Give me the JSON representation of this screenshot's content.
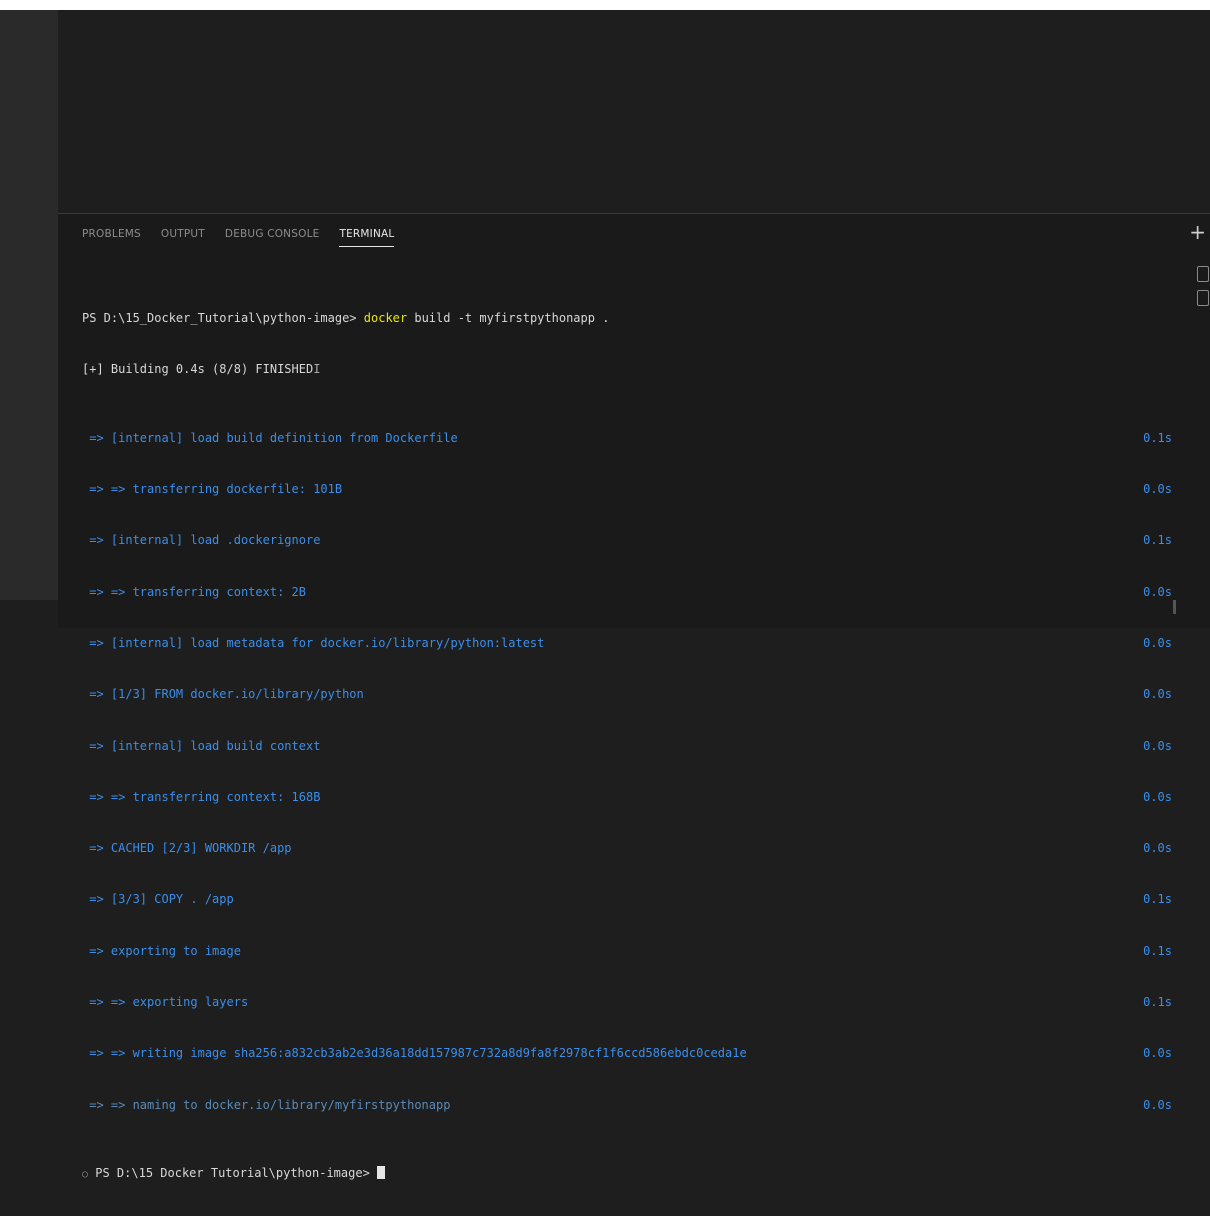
{
  "panel": {
    "tabs": [
      {
        "label": "PROBLEMS"
      },
      {
        "label": "OUTPUT"
      },
      {
        "label": "DEBUG CONSOLE"
      },
      {
        "label": "TERMINAL"
      }
    ],
    "new_terminal": "+"
  },
  "terminal": {
    "prompt1": "PS D:\\15_Docker_Tutorial\\python-image> ",
    "cmd_docker": "docker",
    "cmd_rest": " build -t myfirstpythonapp .",
    "building": "[+] Building 0.4s (8/8) FINISHED",
    "steps": [
      {
        "text": " => [internal] load build definition from Dockerfile",
        "time": "0.1s"
      },
      {
        "text": " => => transferring dockerfile: 101B",
        "time": "0.0s"
      },
      {
        "text": " => [internal] load .dockerignore",
        "time": "0.1s"
      },
      {
        "text": " => => transferring context: 2B",
        "time": "0.0s"
      },
      {
        "text": " => [internal] load metadata for docker.io/library/python:latest",
        "time": "0.0s"
      },
      {
        "text": " => [1/3] FROM docker.io/library/python",
        "time": "0.0s"
      },
      {
        "text": " => [internal] load build context",
        "time": "0.0s"
      },
      {
        "text": " => => transferring context: 168B",
        "time": "0.0s"
      },
      {
        "text": " => CACHED [2/3] WORKDIR /app",
        "time": "0.0s"
      },
      {
        "text": " => [3/3] COPY . /app",
        "time": "0.1s"
      },
      {
        "text": " => exporting to image",
        "time": "0.1s"
      },
      {
        "text": " => => exporting layers",
        "time": "0.1s"
      },
      {
        "text": " => => writing image sha256:a832cb3ab2e3d36a18dd157987c732a8d9fa8f2978cf1f6ccd586ebdc0ceda1e",
        "time": "0.0s"
      },
      {
        "text": " => => naming to docker.io/library/myfirstpythonapp",
        "time": "0.0s"
      }
    ],
    "prompt2_mark": "○",
    "prompt2": " PS D:\\15 Docker Tutorial\\python-image> "
  }
}
